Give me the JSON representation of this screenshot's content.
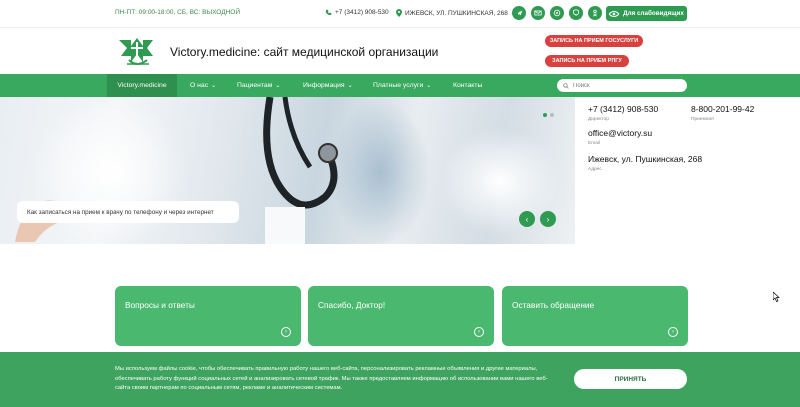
{
  "topbar": {
    "hours": "ПН-ПТ: 09:00-18:00, СБ, ВС: ВЫХОДНОЙ",
    "phone": "+7 (3412) 908-530",
    "address": "ИЖЕВСК, УЛ. ПУШКИНСКАЯ, 268",
    "socials": [
      "telegram-icon",
      "mail-icon",
      "whatsapp-icon",
      "viber-icon",
      "odnoklassniki-icon"
    ],
    "vision_label": "Для слабовидящих"
  },
  "header": {
    "title": "Victory.medicine: сайт медицинской организации",
    "btn_gosuslugi": "ЗАПИСЬ НА ПРИЕМ ГОСУСЛУГИ",
    "btn_prg": "ЗАПИСЬ НА ПРИЕМ РПГУ"
  },
  "nav": {
    "home": "Victory.medicine",
    "items": [
      {
        "label": "О нас",
        "dropdown": true
      },
      {
        "label": "Пациентам",
        "dropdown": true
      },
      {
        "label": "Информация",
        "dropdown": true
      },
      {
        "label": "Платные услуги",
        "dropdown": true
      },
      {
        "label": "Контакты",
        "dropdown": false
      }
    ],
    "search_placeholder": "Поиск"
  },
  "hero": {
    "caption": "Как записаться на прием к врачу по телефону и через интернет",
    "prev": "‹",
    "next": "›"
  },
  "contacts": {
    "director_phone": "+7 (3412) 908-530",
    "director_label": "Директор",
    "reception_phone": "8-800-201-99-42",
    "reception_label": "Приемная",
    "email": "office@victory.su",
    "email_label": "Email",
    "address": "Ижевск, ул. Пушкинская, 268",
    "address_label": "Адрес"
  },
  "cards": [
    {
      "title": "Вопросы и ответы"
    },
    {
      "title": "Спасибо, Доктор!"
    },
    {
      "title": "Оставить обращение"
    }
  ],
  "cookie": {
    "text": "Мы используем файлы cookie, чтобы обеспечивать правильную работу нашего веб-сайта, персонализировать рекламные объявления и другие материалы, обеспечивать работу функций социальных сетей и анализировать сетевой трафик. Мы также предоставляем информацию об использовании вами нашего веб-сайта своим партнерам по социальным сетям, рекламе и аналитическим системам.",
    "accept": "ПРИНЯТЬ"
  },
  "colors": {
    "brand_green": "#3aa960",
    "dark_green": "#2f9a52",
    "red": "#d9413f"
  }
}
